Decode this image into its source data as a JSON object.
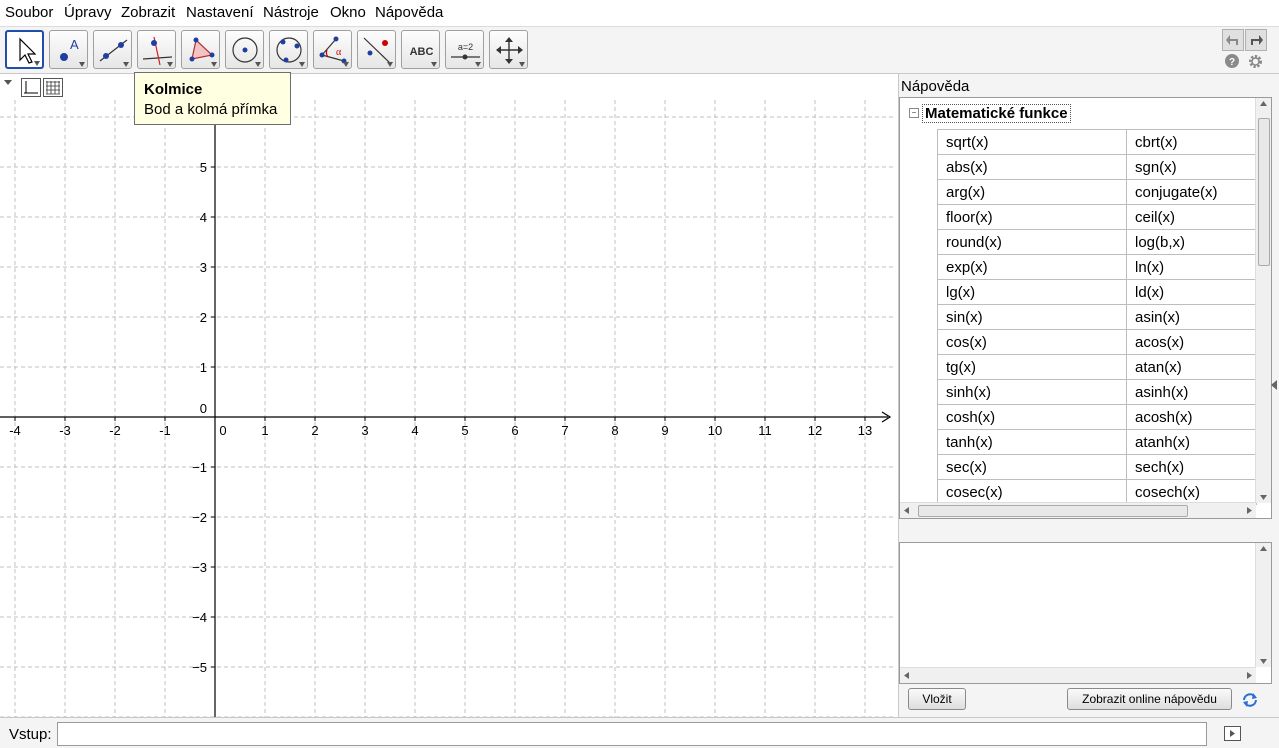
{
  "menu": [
    "Soubor",
    "Úpravy",
    "Zobrazit",
    "Nastavení",
    "Nástroje",
    "Okno",
    "Nápověda"
  ],
  "toolbar": {
    "tools": [
      {
        "name": "move-tool-icon"
      },
      {
        "name": "point-tool-icon"
      },
      {
        "name": "line-tool-icon"
      },
      {
        "name": "perpendicular-line-tool-icon"
      },
      {
        "name": "polygon-tool-icon"
      },
      {
        "name": "circle-center-point-tool-icon"
      },
      {
        "name": "circle-three-points-tool-icon"
      },
      {
        "name": "angle-tool-icon"
      },
      {
        "name": "reflect-tool-icon"
      },
      {
        "name": "text-tool-icon",
        "label": "ABC"
      },
      {
        "name": "slider-tool-icon",
        "label": "a=2"
      },
      {
        "name": "move-graphics-view-tool-icon"
      }
    ],
    "active_index": 0
  },
  "tooltip": {
    "title": "Kolmice",
    "text": "Bod a kolmá přímka"
  },
  "graph": {
    "x_ticks": [
      "-4",
      "-3",
      "-2",
      "-1",
      "0",
      "1",
      "2",
      "3",
      "4",
      "5",
      "6",
      "7",
      "8",
      "9",
      "10",
      "11",
      "12",
      "13"
    ],
    "y_ticks": [
      "5",
      "4",
      "3",
      "2",
      "1",
      "0",
      "−1",
      "−2",
      "−3",
      "−4",
      "−5"
    ],
    "grid": true,
    "axis_color": "#000000",
    "grid_color": "#c0c0c0"
  },
  "help": {
    "title": "Nápověda",
    "section": "Matematické funkce",
    "functions": [
      [
        "sqrt(x)",
        "cbrt(x)"
      ],
      [
        "abs(x)",
        "sgn(x)"
      ],
      [
        "arg(x)",
        "conjugate(x)"
      ],
      [
        "floor(x)",
        "ceil(x)"
      ],
      [
        "round(x)",
        "log(b,x)"
      ],
      [
        "exp(x)",
        "ln(x)"
      ],
      [
        "lg(x)",
        "ld(x)"
      ],
      [
        "sin(x)",
        "asin(x)"
      ],
      [
        "cos(x)",
        "acos(x)"
      ],
      [
        "tg(x)",
        "atan(x)"
      ],
      [
        "sinh(x)",
        "asinh(x)"
      ],
      [
        "cosh(x)",
        "acosh(x)"
      ],
      [
        "tanh(x)",
        "atanh(x)"
      ],
      [
        "sec(x)",
        "sech(x)"
      ],
      [
        "cosec(x)",
        "cosech(x)"
      ]
    ],
    "insert_button": "Vložit",
    "online_help_button": "Zobrazit online nápovědu"
  },
  "input_bar": {
    "label": "Vstup:",
    "value": ""
  }
}
